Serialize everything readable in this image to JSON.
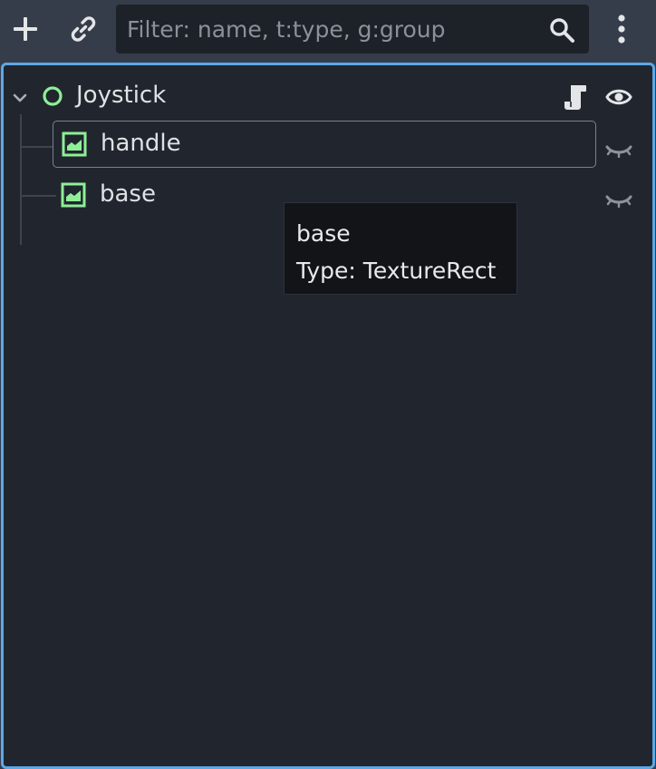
{
  "toolbar": {
    "add_icon": "plus-icon",
    "link_icon": "link-icon",
    "menu_icon": "kebab-menu-icon",
    "filter": {
      "placeholder": "Filter: name, t:type, g:group",
      "value": "",
      "search_icon": "search-icon"
    }
  },
  "tree": {
    "root": {
      "label": "Joystick",
      "expanded": true,
      "type_icon": "node-circle-icon",
      "script_icon": "script-icon",
      "visibility_icon": "eye-icon"
    },
    "children": [
      {
        "label": "handle",
        "type_icon": "texture-rect-icon",
        "visibility_icon": "eye-closed-icon",
        "selected": true
      },
      {
        "label": "base",
        "type_icon": "texture-rect-icon",
        "visibility_icon": "eye-closed-icon",
        "selected": false
      }
    ]
  },
  "tooltip": {
    "name": "base",
    "type_line": "Type: TextureRect"
  },
  "colors": {
    "toolbar_bg": "#363d4a",
    "panel_bg": "#21262e",
    "panel_border": "#5ca8e6",
    "node_green": "#8eef97",
    "text": "#dfe1e5",
    "muted_icon": "#8e939b"
  }
}
